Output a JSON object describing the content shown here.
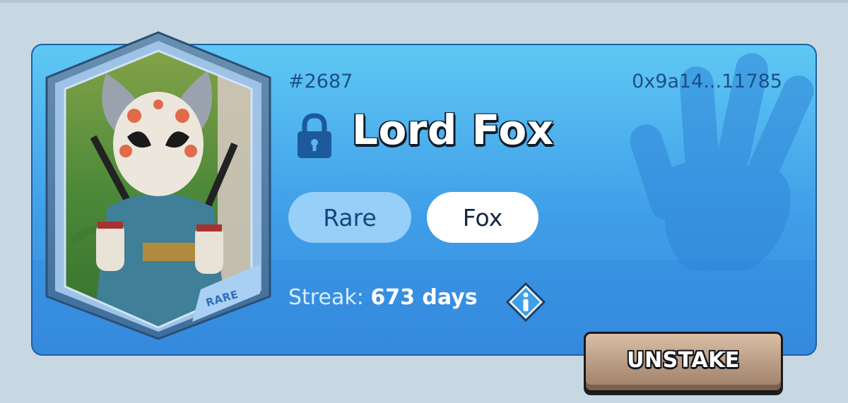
{
  "nft": {
    "token_id": "#2687",
    "owner_address": "0x9a14...11785",
    "name": "Lord Fox",
    "card_rarity_label": "RARE",
    "tags": {
      "rarity": "Rare",
      "species": "Fox"
    },
    "streak": {
      "label": "Streak:",
      "value": "673 days"
    }
  },
  "actions": {
    "unstake_label": "UNSTAKE"
  },
  "icons": {
    "lock": "lock-icon",
    "info": "info-icon",
    "watermark": "hand-icon"
  },
  "colors": {
    "panel_top": "#5fc8f4",
    "panel_bottom": "#3a8fe0",
    "panel_border": "#1e5fa8",
    "text_dark_blue": "#1d4f86",
    "tag_rarity_bg": "#96cff7",
    "tag_species_bg": "#ffffff",
    "button_bg": "#b89a82"
  }
}
